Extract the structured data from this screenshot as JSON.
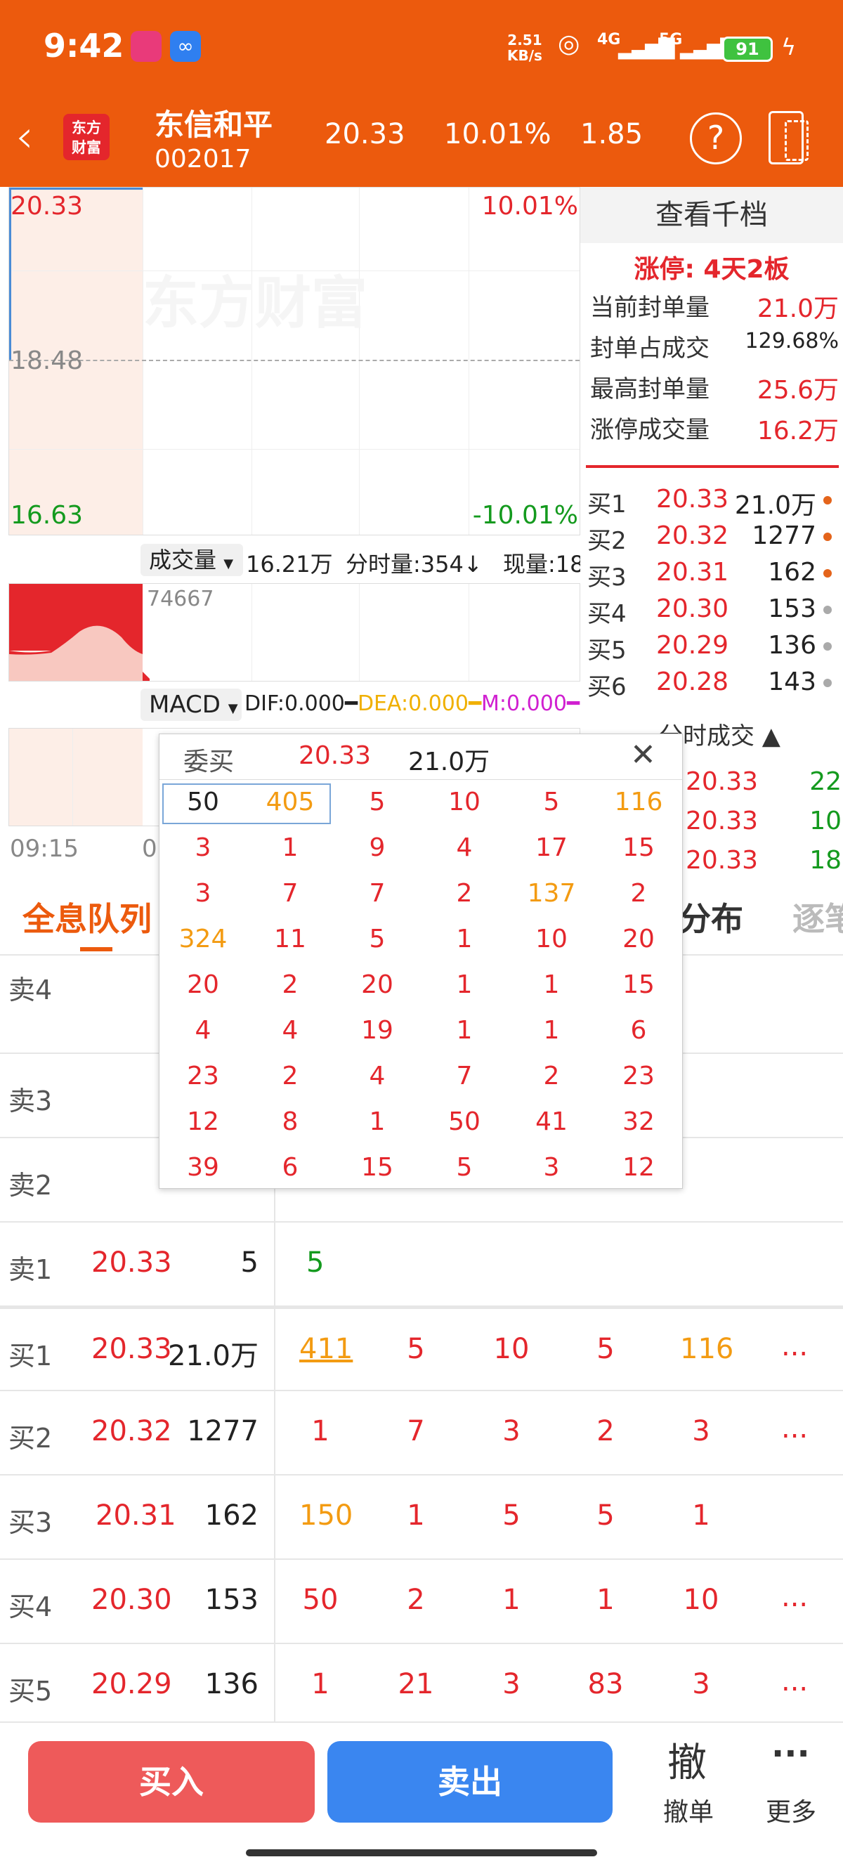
{
  "status": {
    "time": "9:42",
    "speed": "2.51",
    "speed_unit": "KB/s",
    "net1": "4G",
    "net2": "5G",
    "battery": "91"
  },
  "header": {
    "logo_line1": "东方",
    "logo_line2": "财富",
    "name": "东信和平",
    "code": "002017",
    "price": "20.33",
    "pct": "10.01%",
    "change": "1.85",
    "help": "?"
  },
  "chart": {
    "high": "20.33",
    "high_pct": "10.01%",
    "mid": "18.48",
    "low": "16.63",
    "low_pct": "-10.01%",
    "watermark": "东方财富",
    "vol_label": "成交量",
    "vol_value": "16.21万",
    "tick_label": "分时量:354",
    "tick_arrow": "↓",
    "now_label": "现量:18",
    "vol_max": "74667",
    "macd_label": "MACD",
    "dif": "DIF:0.000",
    "dea": "DEA:0.000",
    "m": "M:0.000",
    "time_start": "09:15",
    "time_mid": "0"
  },
  "right": {
    "title": "查看千档",
    "limit": "涨停: 4天2板",
    "stats": [
      {
        "k": "当前封单量",
        "v": "21.0万"
      },
      {
        "k": "封单占成交",
        "v": "129.68%"
      },
      {
        "k": "最高封单量",
        "v": "25.6万"
      },
      {
        "k": "涨停成交量",
        "v": "16.2万"
      }
    ],
    "bids": [
      {
        "l": "买1",
        "p": "20.33",
        "q": "21.0万",
        "c": "#e4641b"
      },
      {
        "l": "买2",
        "p": "20.32",
        "q": "1277",
        "c": "#e4641b"
      },
      {
        "l": "买3",
        "p": "20.31",
        "q": "162",
        "c": "#e4641b"
      },
      {
        "l": "买4",
        "p": "20.30",
        "q": "153",
        "c": "#aaa"
      },
      {
        "l": "买5",
        "p": "20.29",
        "q": "136",
        "c": "#aaa"
      },
      {
        "l": "买6",
        "p": "20.28",
        "q": "143",
        "c": "#aaa"
      }
    ],
    "trades_title": "分时成交",
    "trades": [
      {
        "p": "20.33",
        "q": "22"
      },
      {
        "p": "20.33",
        "q": "10"
      },
      {
        "p": "20.33",
        "q": "18"
      }
    ]
  },
  "tabs": {
    "t1": "全息队列",
    "t2": "分布",
    "t3": "逐笔"
  },
  "popup": {
    "title": "委买",
    "price": "20.33",
    "qty": "21.0万",
    "close": "✕",
    "grid": [
      [
        "50",
        "405",
        "5",
        "10",
        "5",
        "116"
      ],
      [
        "3",
        "1",
        "9",
        "4",
        "17",
        "15"
      ],
      [
        "3",
        "7",
        "7",
        "2",
        "137",
        "2"
      ],
      [
        "324",
        "11",
        "5",
        "1",
        "10",
        "20"
      ],
      [
        "20",
        "2",
        "20",
        "1",
        "1",
        "15"
      ],
      [
        "4",
        "4",
        "19",
        "1",
        "1",
        "6"
      ],
      [
        "23",
        "2",
        "4",
        "7",
        "2",
        "23"
      ],
      [
        "12",
        "8",
        "1",
        "50",
        "41",
        "32"
      ],
      [
        "39",
        "6",
        "15",
        "5",
        "3",
        "12"
      ]
    ]
  },
  "queue": {
    "sells": [
      {
        "l": "卖4"
      },
      {
        "l": "卖3"
      },
      {
        "l": "卖2"
      },
      {
        "l": "卖1",
        "p": "20.33",
        "q": "5",
        "o": [
          "5"
        ]
      }
    ],
    "buys": [
      {
        "l": "买1",
        "p": "20.33",
        "q": "21.0万",
        "o": [
          "411",
          "5",
          "10",
          "5",
          "116"
        ],
        "more": "..."
      },
      {
        "l": "买2",
        "p": "20.32",
        "q": "1277",
        "o": [
          "1",
          "7",
          "3",
          "2",
          "3"
        ],
        "more": "..."
      },
      {
        "l": "买3",
        "p": "20.31",
        "q": "162",
        "o": [
          "150",
          "1",
          "5",
          "5",
          "1"
        ],
        "more": ""
      },
      {
        "l": "买4",
        "p": "20.30",
        "q": "153",
        "o": [
          "50",
          "2",
          "1",
          "1",
          "10"
        ],
        "more": "..."
      },
      {
        "l": "买5",
        "p": "20.29",
        "q": "136",
        "o": [
          "1",
          "21",
          "3",
          "83",
          "3"
        ],
        "more": "..."
      }
    ]
  },
  "bottom": {
    "buy": "买入",
    "sell": "卖出",
    "cancel_icon": "撤",
    "cancel": "撤单",
    "more_icon": "···",
    "more": "更多"
  }
}
